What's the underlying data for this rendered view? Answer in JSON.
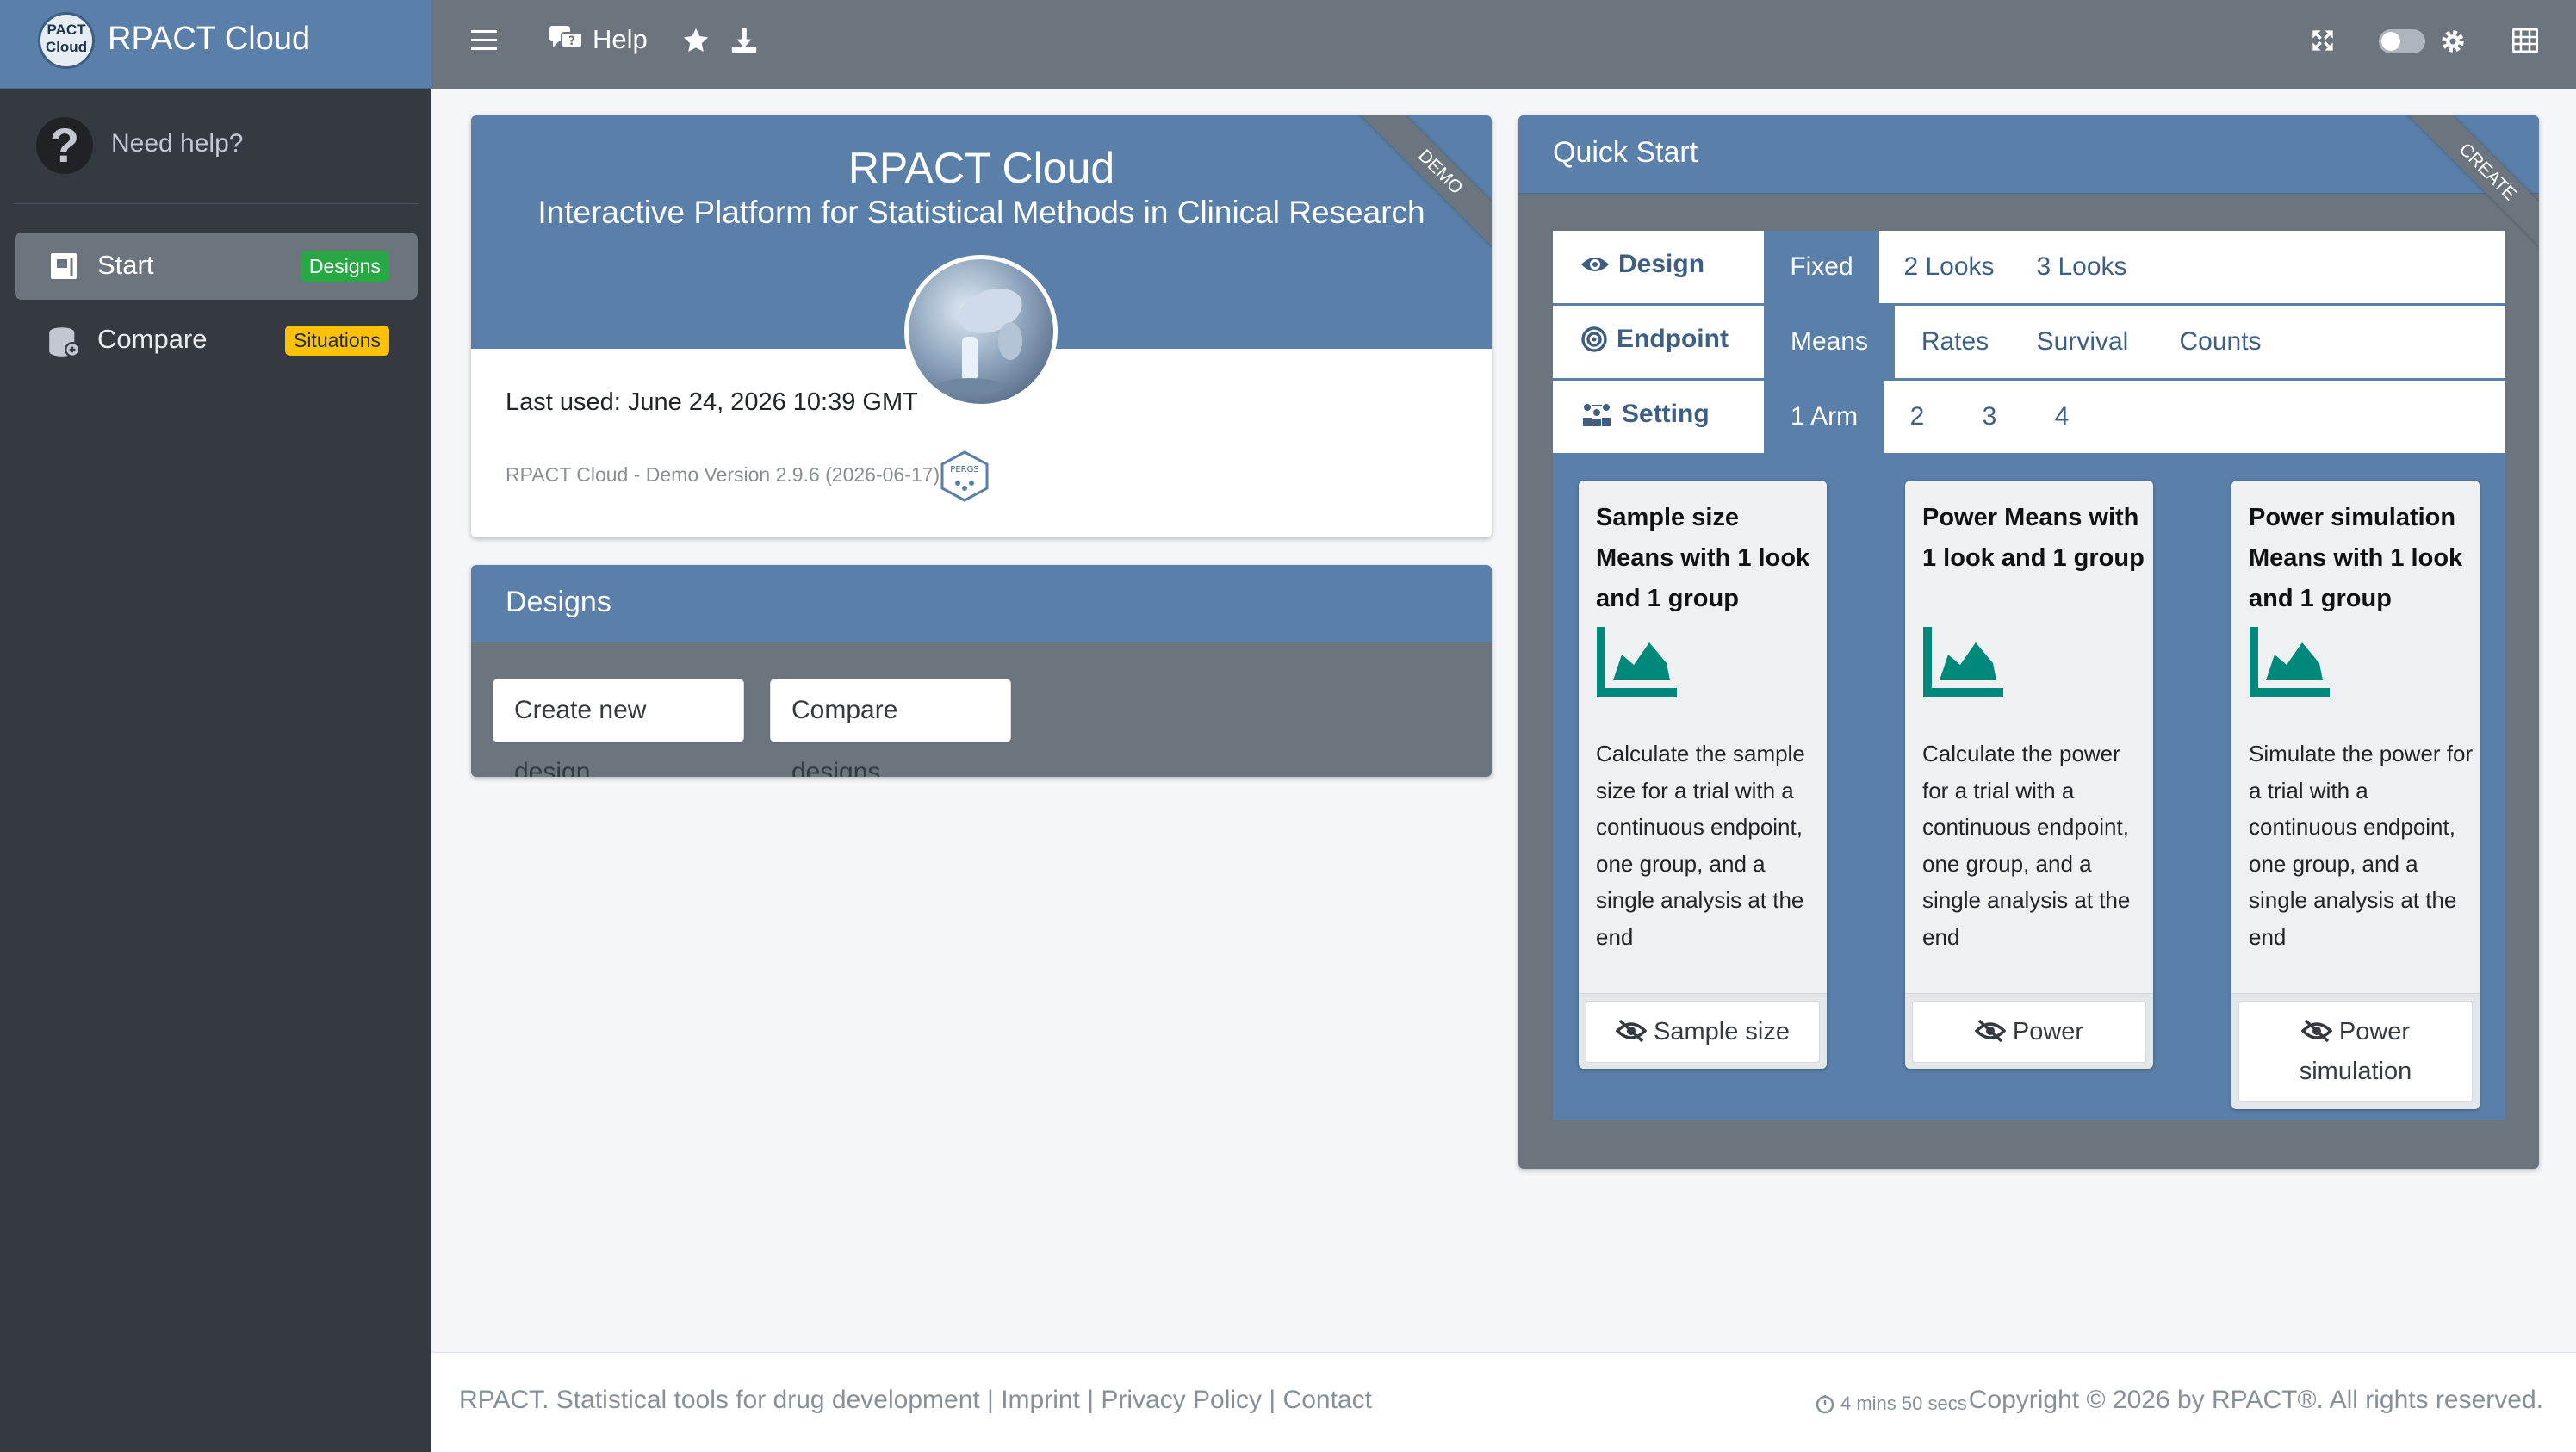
{
  "brand": {
    "logo_text_1": "PACT",
    "logo_text_2": "Cloud",
    "name": "RPACT Cloud"
  },
  "sidebar": {
    "help_text": "Need help?",
    "items": [
      {
        "label": "Start",
        "badge": "Designs",
        "badge_color": "#28a745"
      },
      {
        "label": "Compare",
        "badge": "Situations",
        "badge_color": "#ffc107"
      }
    ]
  },
  "topbar": {
    "help_label": "Help"
  },
  "demo_card": {
    "ribbon": "DEMO",
    "title": "RPACT Cloud",
    "subtitle": "Interactive Platform for Statistical Methods in Clinical Research",
    "last_used": "Last used: June 24, 2026 10:39 GMT",
    "version": "RPACT Cloud - Demo Version 2.9.6 (2026-06-17)",
    "hex_label": "PERGS"
  },
  "designs_card": {
    "title": "Designs",
    "create_button": "Create new design",
    "compare_button": "Compare designs"
  },
  "quick_start": {
    "title": "Quick Start",
    "ribbon": "CREATE",
    "rows": [
      {
        "label": "Design",
        "options": [
          "Fixed",
          "2 Looks",
          "3 Looks"
        ],
        "selected": "Fixed"
      },
      {
        "label": "Endpoint",
        "options": [
          "Means",
          "Rates",
          "Survival",
          "Counts"
        ],
        "selected": "Means"
      },
      {
        "label": "Setting",
        "options": [
          "1 Arm",
          "2",
          "3",
          "4"
        ],
        "selected": "1 Arm"
      }
    ],
    "cards": [
      {
        "title": "Sample size Means with 1 look and 1 group",
        "description": "Calculate the sample size for a trial with a continuous endpoint, one group, and a single analysis at the end",
        "button": "Sample size"
      },
      {
        "title": "Power Means with 1 look and 1 group",
        "description": "Calculate the power for a trial with a continuous endpoint, one group, and a single analysis at the end",
        "button": "Power"
      },
      {
        "title": "Power simulation Means with 1 look and 1 group",
        "description": "Simulate the power for a trial with a continuous endpoint, one group, and a single analysis at the end",
        "button": "Power simulation"
      }
    ]
  },
  "footer": {
    "tagline": "RPACT. Statistical tools for drug development",
    "links": [
      "Imprint",
      "Privacy Policy",
      "Contact"
    ],
    "separator": " | ",
    "session_time": "4 mins 50 secs",
    "copyright": "Copyright © 2026 by RPACT®. All rights reserved."
  },
  "colors": {
    "primary": "#5a7fa8",
    "sidebar": "#343a40",
    "topbar": "#6c757d",
    "link": "#3e5f84"
  }
}
